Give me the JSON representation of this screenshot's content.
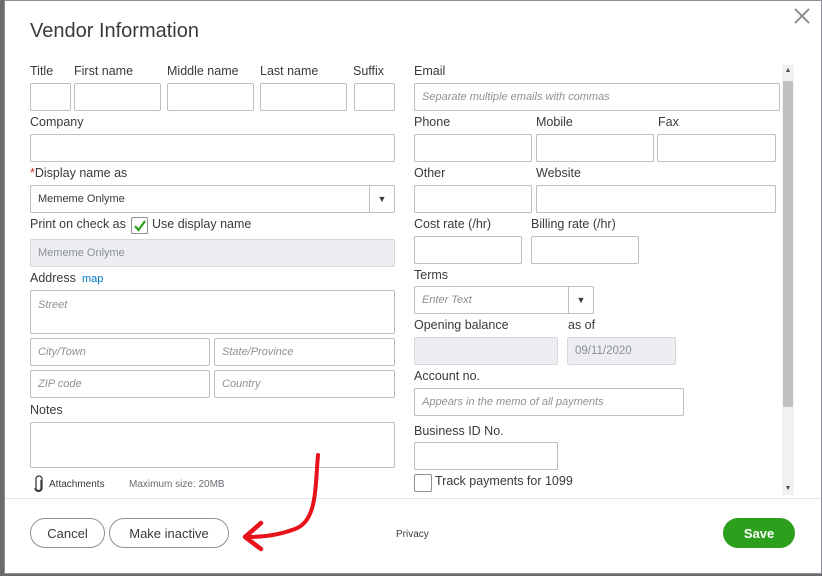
{
  "dialog": {
    "title": "Vendor Information"
  },
  "name": {
    "title_label": "Title",
    "first_label": "First name",
    "middle_label": "Middle name",
    "last_label": "Last name",
    "suffix_label": "Suffix"
  },
  "company": {
    "label": "Company"
  },
  "display_name": {
    "required_mark": "*",
    "label": "Display name as",
    "value": "Mememe Onlyme"
  },
  "print_on_check": {
    "label": "Print on check as",
    "checkbox_label": "Use display name",
    "checked": true,
    "value": "Mememe Onlyme"
  },
  "address": {
    "label": "Address",
    "map_link": "map",
    "street_placeholder": "Street",
    "city_placeholder": "City/Town",
    "state_placeholder": "State/Province",
    "zip_placeholder": "ZIP code",
    "country_placeholder": "Country"
  },
  "notes": {
    "label": "Notes"
  },
  "attachments": {
    "label": "Attachments",
    "max_size": "Maximum size: 20MB"
  },
  "email": {
    "label": "Email",
    "placeholder": "Separate multiple emails with commas"
  },
  "phones": {
    "phone_label": "Phone",
    "mobile_label": "Mobile",
    "fax_label": "Fax",
    "other_label": "Other",
    "website_label": "Website"
  },
  "rates": {
    "cost_label": "Cost rate (/hr)",
    "billing_label": "Billing rate (/hr)"
  },
  "terms": {
    "label": "Terms",
    "placeholder": "Enter Text"
  },
  "opening_balance": {
    "label": "Opening balance",
    "as_of_label": "as of",
    "as_of_value": "09/11/2020"
  },
  "account_no": {
    "label": "Account no.",
    "placeholder": "Appears in the memo of all payments"
  },
  "business_id": {
    "label": "Business ID No."
  },
  "track_1099": {
    "label": "Track payments for 1099",
    "checked": false
  },
  "footer": {
    "cancel": "Cancel",
    "make_inactive": "Make inactive",
    "privacy": "Privacy",
    "save": "Save"
  },
  "colors": {
    "accent_green": "#2ca01c",
    "link_blue": "#0077c5",
    "annotation_red": "#e8121b"
  }
}
